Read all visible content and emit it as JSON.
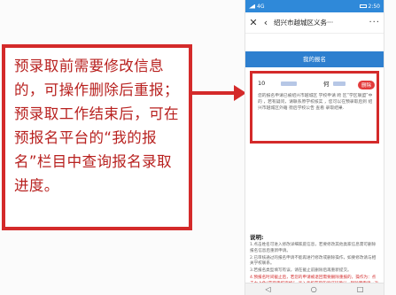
{
  "callout": {
    "text": "预录取前需要修改信息的，可操作删除后重报；预录取工作结束后，可在预报名平台的“我的报名”栏目中查询报名录取进度。"
  },
  "phone": {
    "status": {
      "time": "2:50",
      "network": "4G"
    },
    "nav": {
      "close_icon": "close-icon",
      "back_icon": "back-arrow-icon",
      "title": "绍兴市越城区义务···",
      "more": "···"
    },
    "page_header": "我的报名",
    "record": {
      "id_prefix": "10",
      "name_prefix": "何",
      "delete_label": "删除",
      "description": "您的报名申请已被绍兴市越城区 学校申请 跨 区“学区联盟”中的 ，若有疑问，请联系原学校核实 ，您可以在预录取后到 绍兴市越城区外籍 街后学校公告 查看 录取结果."
    },
    "notes": {
      "title": "说明:",
      "items": [
        {
          "text": "1.点击姓名可进入修改详细家庭信息，若要修改其他类家信息需可删除报名信息后重新申请。",
          "red": false
        },
        {
          "text": "2.已审核通过的报名申请不能再进行修改或删除操作，如要修改请与相关学校联系。",
          "red": false
        },
        {
          "text": "3.若报名类型填写有误，请在截止前删除后再重新提交。",
          "red": false
        },
        {
          "text": "4.预报名时间截止后，若您的申请被退回需要删除重报的，操作为：点击右上角“获取重报资格”→录入手机获取的验证码确认→删除原申请→返回首页重新申请。重报申请每人最多3次，须获取重报资格后方可完成。",
          "red": true
        }
      ]
    },
    "bottom": [
      "back-triangle-icon",
      "home-circle-icon",
      "recent-square-icon"
    ]
  },
  "colors": {
    "accent_red": "#d42a2a",
    "header_blue": "#2d7fcf",
    "status_blue": "#2f89d9"
  }
}
